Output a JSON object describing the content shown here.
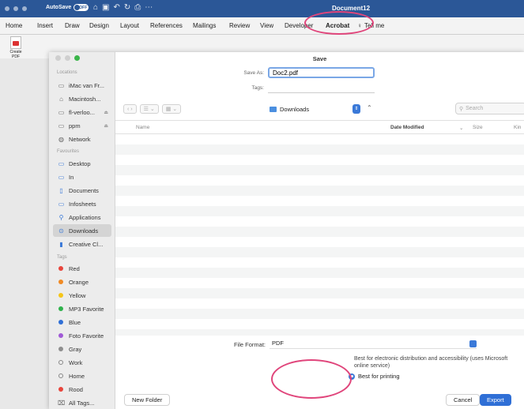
{
  "app": {
    "autosave_label": "AutoSave",
    "autosave_state": "OFF",
    "document_title": "Document12"
  },
  "ribbon": {
    "tabs": [
      {
        "label": "Home"
      },
      {
        "label": "Insert"
      },
      {
        "label": "Draw"
      },
      {
        "label": "Design"
      },
      {
        "label": "Layout"
      },
      {
        "label": "References"
      },
      {
        "label": "Mailings"
      },
      {
        "label": "Review"
      },
      {
        "label": "View"
      },
      {
        "label": "Developer"
      },
      {
        "label": "Acrobat"
      },
      {
        "label": "Tell me"
      }
    ],
    "create_pdf_label": "Create PDF"
  },
  "dialog": {
    "title": "Save",
    "save_as_label": "Save As:",
    "save_as_value": "Doc2.pdf",
    "tags_label": "Tags:",
    "location": "Downloads",
    "search_placeholder": "Search",
    "columns": {
      "name": "Name",
      "date_modified": "Date Modified",
      "size": "Size",
      "kind": "Kin"
    },
    "file_format_label": "File Format:",
    "file_format_value": "PDF",
    "option_electronic": "Best for electronic distribution and accessibility (uses Microsoft online service)",
    "option_printing": "Best for printing",
    "new_folder_label": "New Folder",
    "cancel_label": "Cancel",
    "export_label": "Export"
  },
  "sidebar": {
    "locations_heading": "Locations",
    "locations": [
      {
        "label": "iMac van Fr..."
      },
      {
        "label": "Macintosh..."
      },
      {
        "label": "fl-verloo..."
      },
      {
        "label": "ppm"
      },
      {
        "label": "Network"
      }
    ],
    "favourites_heading": "Favourites",
    "favourites": [
      {
        "label": "Desktop"
      },
      {
        "label": "In"
      },
      {
        "label": "Documents"
      },
      {
        "label": "Infosheets"
      },
      {
        "label": "Applications"
      },
      {
        "label": "Downloads"
      },
      {
        "label": "Creative Cl..."
      }
    ],
    "tags_heading": "Tags",
    "tags": [
      {
        "label": "Red",
        "color": "#e8453c"
      },
      {
        "label": "Orange",
        "color": "#f08a24"
      },
      {
        "label": "Yellow",
        "color": "#f5c518"
      },
      {
        "label": "MP3 Favorite",
        "color": "#2fb24c"
      },
      {
        "label": "Blue",
        "color": "#2f6fd6"
      },
      {
        "label": "Foto Favorite",
        "color": "#a05ad6"
      },
      {
        "label": "Gray",
        "color": "#8e8e8e"
      },
      {
        "label": "Work",
        "color": ""
      },
      {
        "label": "Home",
        "color": ""
      },
      {
        "label": "Rood",
        "color": "#e8453c"
      },
      {
        "label": "All Tags...",
        "color": ""
      }
    ]
  },
  "colors": {
    "word_blue": "#2b5797",
    "accent": "#2f6fd6",
    "highlight_ring": "#e0457b"
  }
}
